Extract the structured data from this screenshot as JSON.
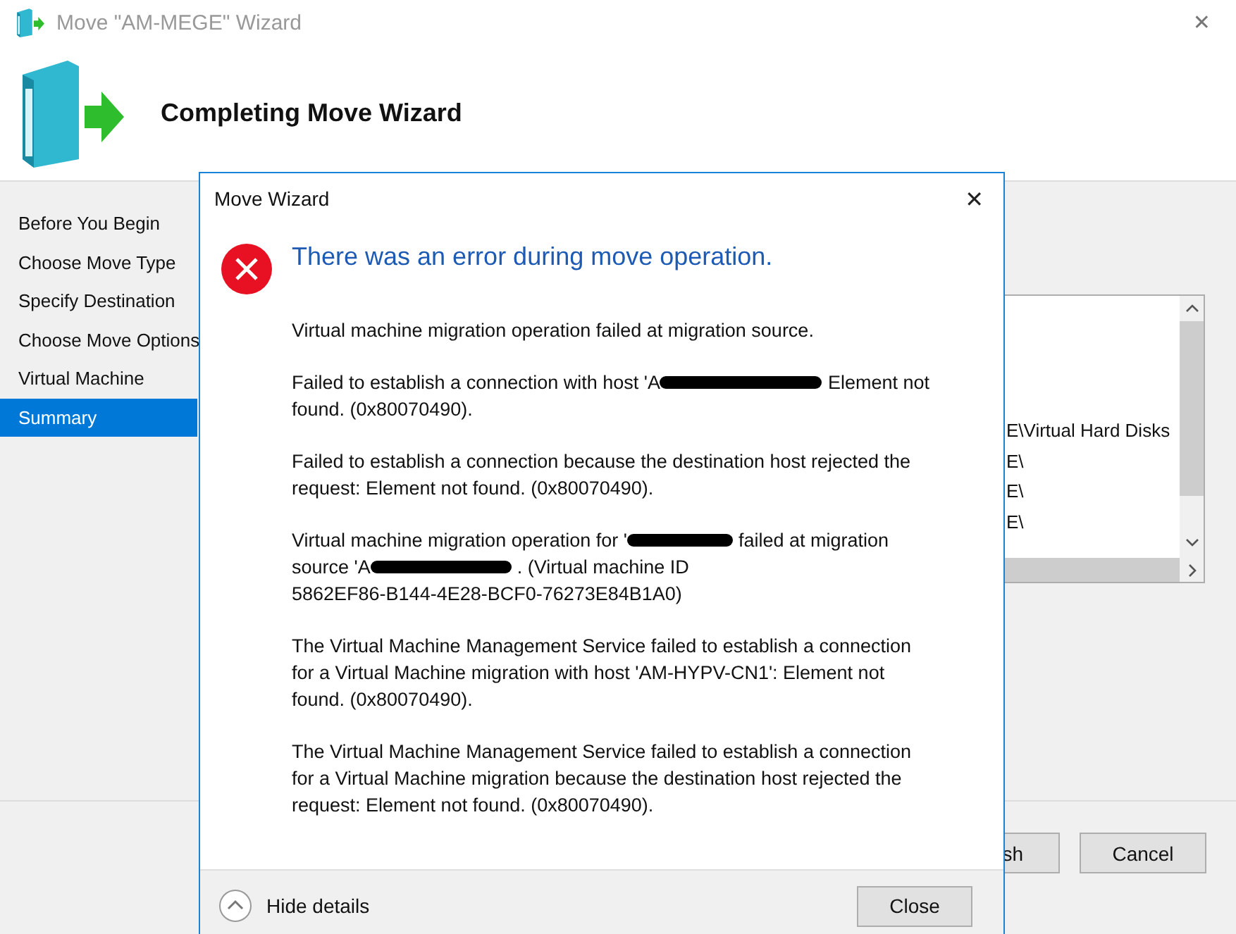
{
  "window": {
    "title": "Move \"AM-MEGE\" Wizard",
    "close": "✕"
  },
  "header": {
    "title": "Completing Move Wizard"
  },
  "nav": [
    {
      "label": "Before You Begin",
      "selected": false
    },
    {
      "label": "Choose Move Type",
      "selected": false
    },
    {
      "label": "Specify Destination",
      "selected": false
    },
    {
      "label": "Choose Move Options",
      "selected": false
    },
    {
      "label": "Virtual Machine",
      "selected": false
    },
    {
      "label": "Summary",
      "selected": true
    }
  ],
  "listbox": {
    "rows": [
      "",
      "",
      "",
      "",
      "E\\Virtual Hard Disks",
      "E\\",
      "E\\",
      "E\\"
    ]
  },
  "buttons": [
    {
      "label": "sh"
    },
    {
      "label": "Cancel"
    }
  ],
  "dialog": {
    "title": "Move Wizard",
    "close": "✕",
    "heading": "There was an error during move operation.",
    "paragraphs": [
      {
        "lines": [
          [
            {
              "kind": "text",
              "text": "Virtual machine migration operation failed at migration source."
            }
          ]
        ]
      },
      {
        "lines": [
          [
            {
              "kind": "text",
              "text": "Failed to establish a connection with host 'A"
            },
            {
              "kind": "redacted"
            },
            {
              "kind": "text",
              "text": "Element not"
            }
          ],
          [
            {
              "kind": "text",
              "text": "found. (0x80070490)."
            }
          ]
        ]
      },
      {
        "lines": [
          [
            {
              "kind": "text",
              "text": "Failed to establish a connection because the destination host rejected the"
            }
          ],
          [
            {
              "kind": "text",
              "text": "request: Element not found. (0x80070490)."
            }
          ]
        ]
      },
      {
        "lines": [
          [
            {
              "kind": "text",
              "text": "Virtual machine migration operation for '"
            },
            {
              "kind": "redacted"
            },
            {
              "kind": "text",
              "text": "failed at migration"
            }
          ],
          [
            {
              "kind": "text",
              "text": "source 'A"
            },
            {
              "kind": "redacted"
            },
            {
              "kind": "text",
              "text": ". (Virtual machine ID"
            }
          ],
          [
            {
              "kind": "text",
              "text": "5862EF86-B144-4E28-BCF0-76273E84B1A0)"
            }
          ]
        ]
      },
      {
        "lines": [
          [
            {
              "kind": "text",
              "text": "The Virtual Machine Management Service failed to establish a connection"
            }
          ],
          [
            {
              "kind": "text",
              "text": "for a Virtual Machine migration with host 'AM-HYPV-CN1': Element not"
            }
          ],
          [
            {
              "kind": "text",
              "text": "found. (0x80070490)."
            }
          ]
        ]
      },
      {
        "lines": [
          [
            {
              "kind": "text",
              "text": "The Virtual Machine Management Service failed to establish a connection"
            }
          ],
          [
            {
              "kind": "text",
              "text": "for a Virtual Machine migration because the destination host rejected the"
            }
          ],
          [
            {
              "kind": "text",
              "text": "request: Element not found. (0x80070490)."
            }
          ]
        ]
      }
    ],
    "details_toggle": {
      "label": "Hide details",
      "expanded": true
    },
    "button": "Close"
  }
}
